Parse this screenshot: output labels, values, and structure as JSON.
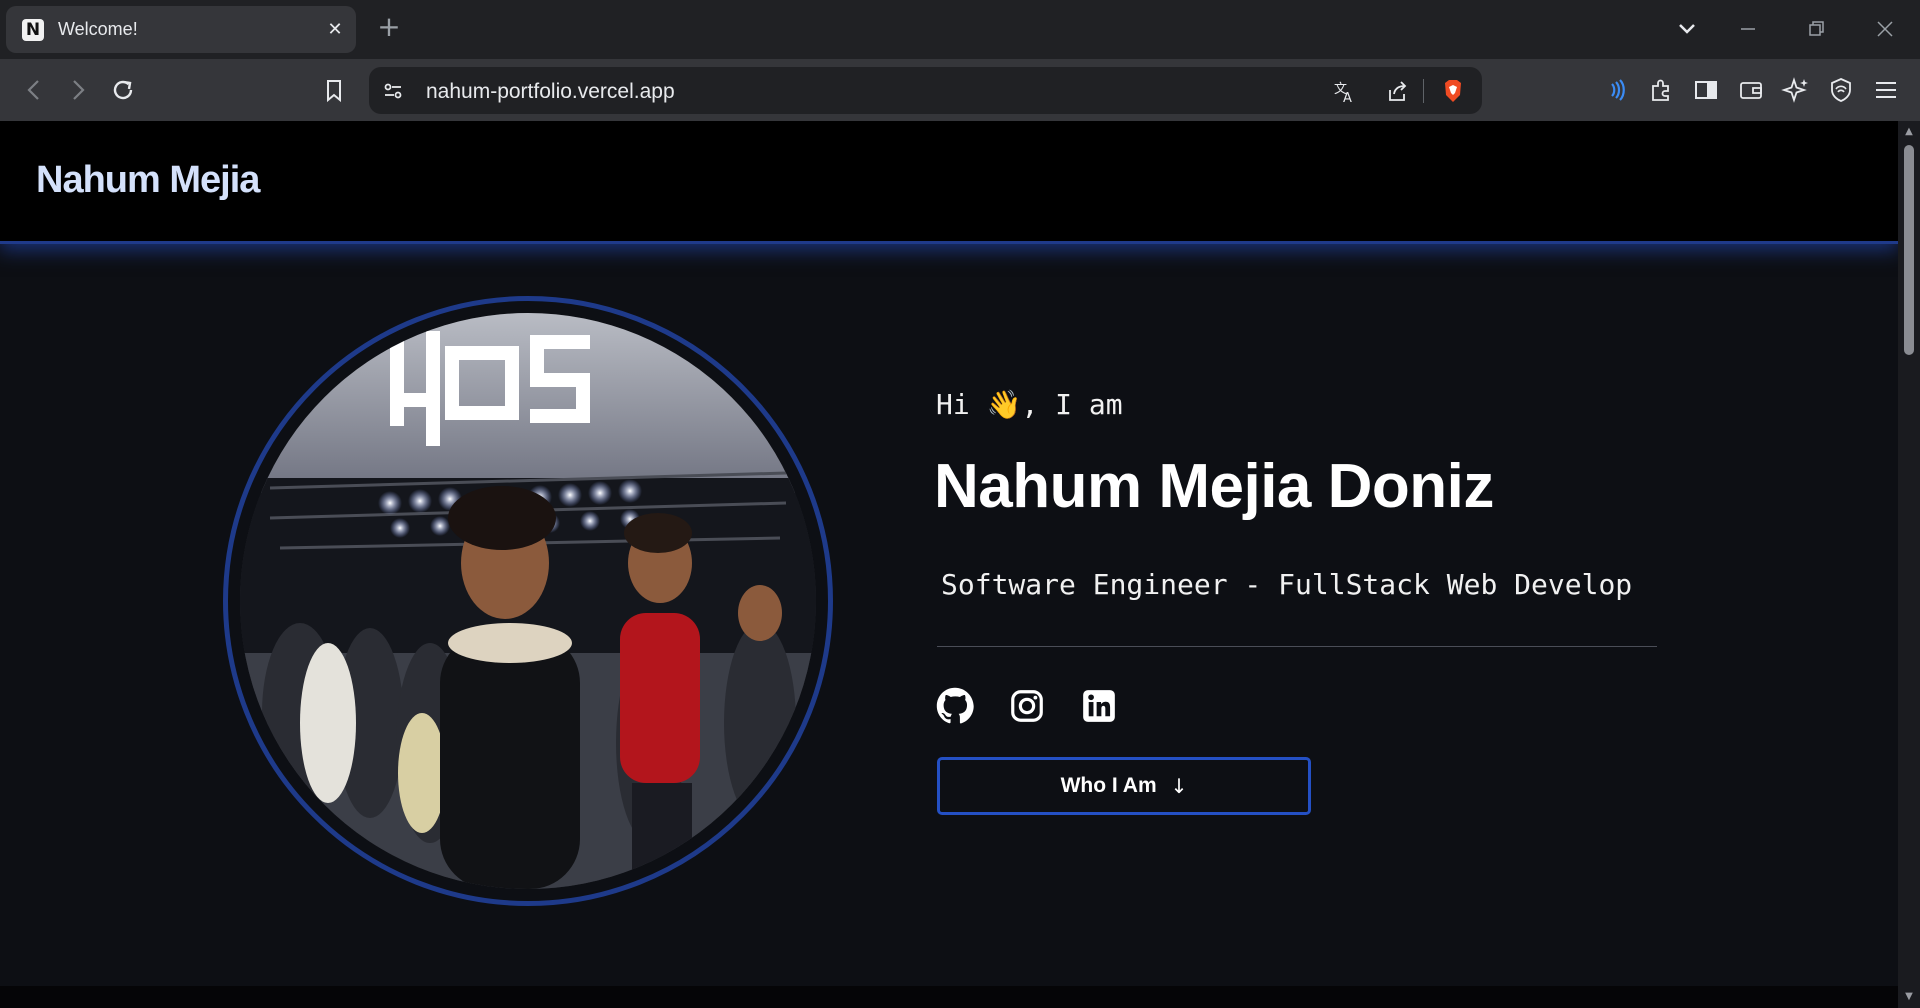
{
  "browser": {
    "tab": {
      "favicon": "N",
      "title": "Welcome!",
      "close": "✕"
    },
    "new_tab": "+",
    "url": "nahum-portfolio.vercel.app",
    "window": {
      "dropdown": "⌄",
      "minimize": "─",
      "restore": "❐",
      "close": "✕"
    },
    "icons": [
      "back-icon",
      "forward-icon",
      "reload-icon",
      "bookmark-icon",
      "site-info-icon",
      "translate-icon",
      "share-icon",
      "brave-shields-icon",
      "speedreader-icon",
      "extensions-icon",
      "sidebar-icon",
      "wallet-icon",
      "leo-ai-icon",
      "vpn-icon",
      "menu-icon"
    ]
  },
  "page": {
    "brand": "Nahum Mejia",
    "greeting_hi": "Hi",
    "greeting_wave": "👋",
    "greeting_rest": ", I am",
    "name": "Nahum Mejia Doniz",
    "role": "Software Engineer - FullStack Web Develop",
    "socials": [
      "github-icon",
      "instagram-icon",
      "linkedin-icon"
    ],
    "cta_label": "Who I Am",
    "cta_arrow": "↓"
  },
  "colors": {
    "accent": "#1e3a8a",
    "cta_border": "#2450c4",
    "brand_text": "#d4e1fb",
    "background": "#0d0f14"
  }
}
